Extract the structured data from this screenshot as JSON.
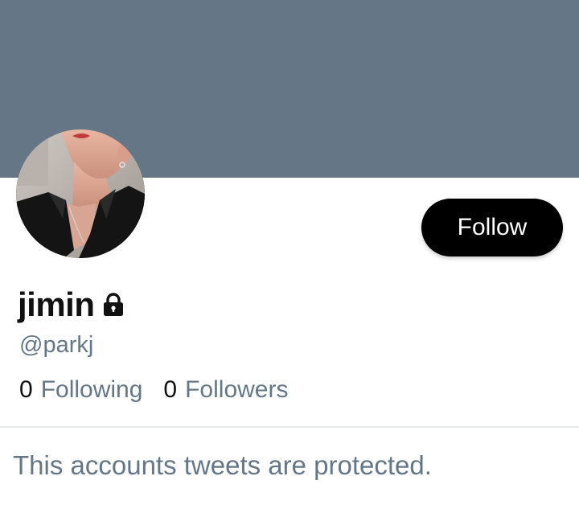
{
  "banner": {
    "color": "#657786"
  },
  "profile": {
    "display_name": "jimin",
    "handle": "@parkj",
    "protected": true,
    "lock_icon": "lock-icon",
    "avatar_icon": "avatar"
  },
  "actions": {
    "follow_label": "Follow"
  },
  "stats": {
    "following_count": "0",
    "following_label": "Following",
    "followers_count": "0",
    "followers_label": "Followers"
  },
  "message": {
    "text": "This accounts tweets are protected."
  },
  "colors": {
    "primary_text": "#111111",
    "secondary_text": "#657786",
    "button_bg": "#000000",
    "button_text": "#ffffff"
  }
}
